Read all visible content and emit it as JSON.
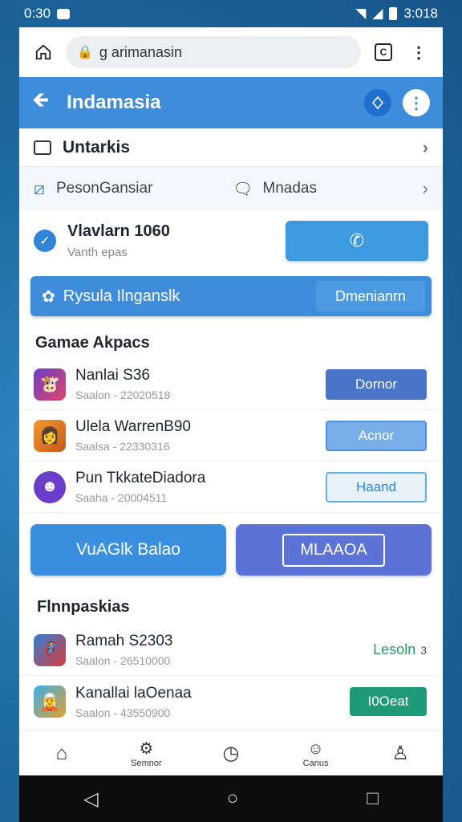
{
  "statusbar": {
    "time": "0:30",
    "clock": "3:018"
  },
  "browser": {
    "url": "g arimanasin"
  },
  "appbar": {
    "title": "Indamasia"
  },
  "menu": {
    "item1": "Untarkis",
    "item2a": "PesonGansiar",
    "item2b": "Mnadas"
  },
  "card": {
    "title": "Vlavlarn 1060",
    "subtitle": "Vanth   epas"
  },
  "banner": {
    "label": "Rysula Ilnganslk",
    "button": "Dmenianrn"
  },
  "games": {
    "header": "Gamae Akpacs",
    "items": [
      {
        "title": "Nanlai S36",
        "subtitle": "Saalon - 22020518",
        "button": "Dornor"
      },
      {
        "title": "Ulela WarrenB90",
        "subtitle": "Saalsa - 22330316",
        "button": "Acnor"
      },
      {
        "title": "Pun TkkateDiadora",
        "subtitle": "Saaha - 20004511",
        "button": "Haand"
      }
    ]
  },
  "bigbuttons": {
    "left": "VuAGlk Balao",
    "right": "MLAAOA"
  },
  "section2": {
    "header": "Flnnpaskias",
    "items": [
      {
        "title": "Ramah S2303",
        "subtitle": "Saalon - 26510000",
        "action": "Lesoln",
        "count": "3"
      },
      {
        "title": "Kanallai laOenaa",
        "subtitle": "Saalon - 43550900",
        "action": "I0Oeat"
      }
    ]
  },
  "bottomnav": {
    "item2": "Semnor",
    "item4": "Canus"
  }
}
